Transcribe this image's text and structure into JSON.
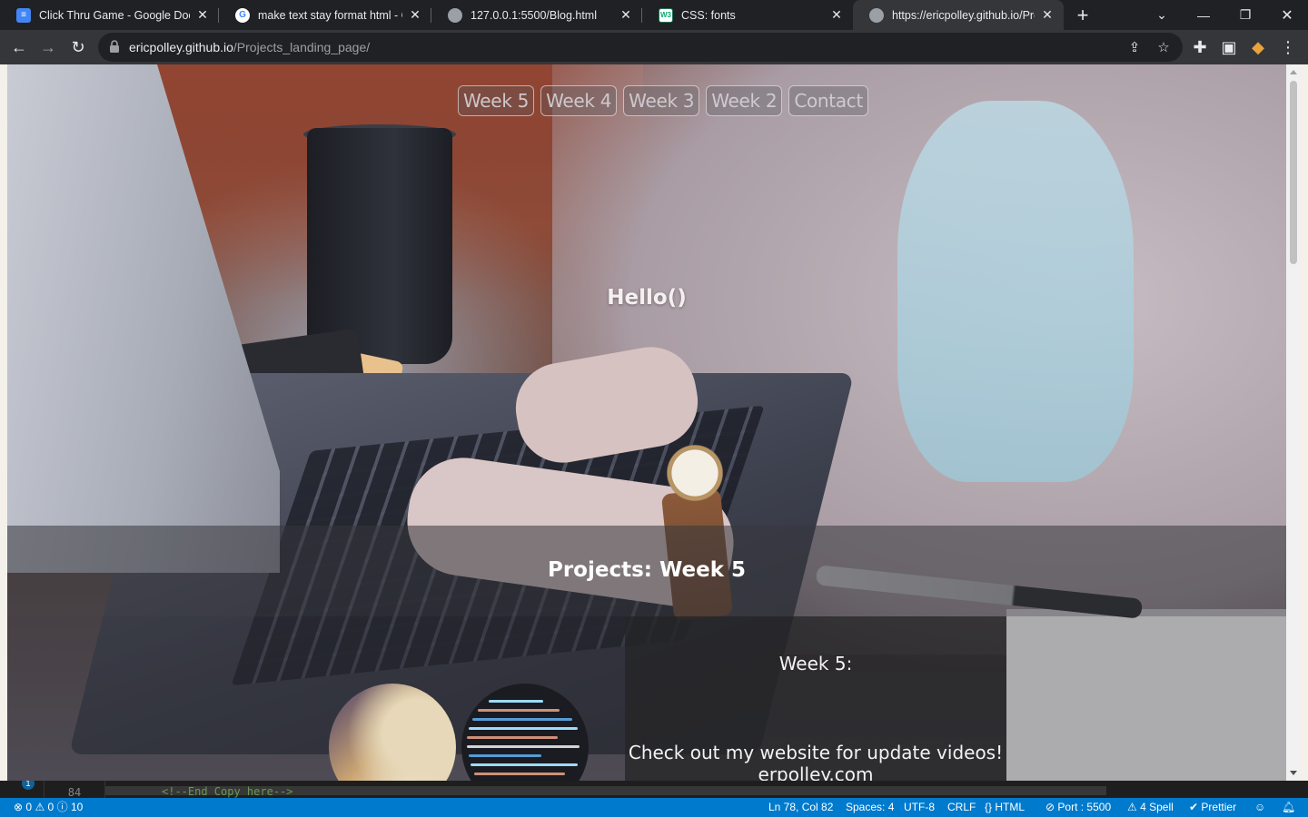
{
  "browser": {
    "tabs": [
      {
        "title": "Click Thru Game - Google Docs",
        "icon": "google-docs-icon",
        "active": false
      },
      {
        "title": "make text stay format html - Go",
        "icon": "google-icon",
        "active": false
      },
      {
        "title": "127.0.0.1:5500/Blog.html",
        "icon": "globe-icon",
        "active": false
      },
      {
        "title": "CSS: fonts",
        "icon": "w3schools-icon",
        "active": false
      },
      {
        "title": "https://ericpolley.github.io/Proj",
        "icon": "globe-icon",
        "active": true
      }
    ],
    "favicon_text": {
      "w3": "W3"
    },
    "url_host": "ericpolley.github.io",
    "url_path": "/Projects_landing_page/"
  },
  "page": {
    "nav": [
      "Week 5",
      "Week 4",
      "Week 3",
      "Week 2",
      "Contact"
    ],
    "hello": "Hello()",
    "projects_heading": "Projects: Week 5",
    "week_title": "Week 5:",
    "week_message": "Check out my website for update videos!",
    "week_link": "erpolley.com"
  },
  "editor": {
    "line_number": "84",
    "code_line": "<!--End Copy here-->",
    "badge_count": "1"
  },
  "statusbar": {
    "errors": "0",
    "warnings": "0",
    "infos": "10",
    "position": "Ln 78, Col 82",
    "spaces": "Spaces: 4",
    "encoding": "UTF-8",
    "eol": "CRLF",
    "language": "HTML",
    "port": "Port : 5500",
    "spell": "4 Spell",
    "prettier": "Prettier"
  },
  "colors": {
    "statusbar": "#007acc",
    "tabstrip": "#202124",
    "toolbar": "#35363a"
  }
}
